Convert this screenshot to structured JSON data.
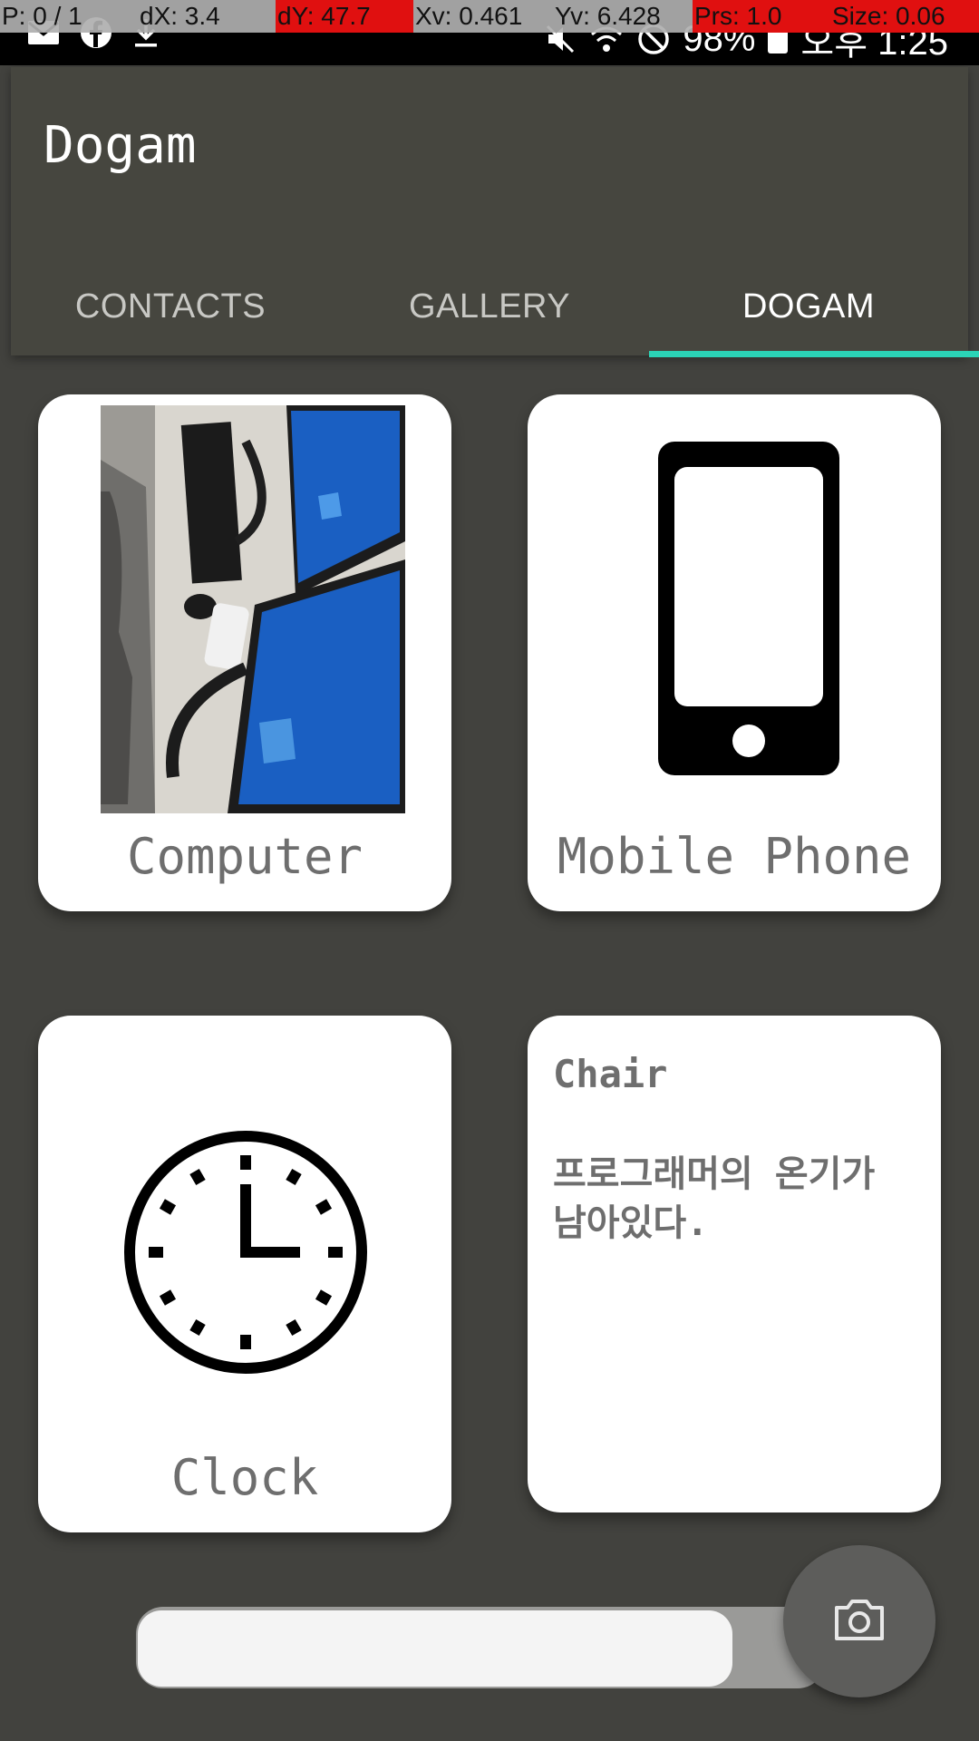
{
  "debug_overlay": {
    "pointer": "P: 0 / 1",
    "dx": "dX: 3.4",
    "dy": "dY: 47.7",
    "xv": "Xv: 0.461",
    "yv": "Yv: 6.428",
    "prs": "Prs: 1.0",
    "size": "Size: 0.06"
  },
  "status_bar": {
    "battery": "98%",
    "time": "오후 1:25",
    "left_icons": [
      "gmail-icon",
      "facebook-icon",
      "download-icon"
    ],
    "right_icons": [
      "mute-icon",
      "wifi-icon",
      "do-not-disturb-icon",
      "battery-icon"
    ]
  },
  "app": {
    "title": "Dogam"
  },
  "tabs": [
    {
      "label": "CONTACTS",
      "active": false
    },
    {
      "label": "GALLERY",
      "active": false
    },
    {
      "label": "DOGAM",
      "active": true
    }
  ],
  "accent_color": "#2bd3b6",
  "cards": [
    {
      "label": "Computer",
      "type": "photo"
    },
    {
      "label": "Mobile Phone",
      "type": "icon",
      "icon": "smartphone-icon"
    },
    {
      "label": "Clock",
      "type": "icon",
      "icon": "clock-icon"
    },
    {
      "label": "Chair",
      "type": "text",
      "description": "프로그래머의 온기가 남아있다."
    }
  ],
  "bottom_bar": {
    "input_value": "",
    "camera_icon": "camera-icon"
  }
}
